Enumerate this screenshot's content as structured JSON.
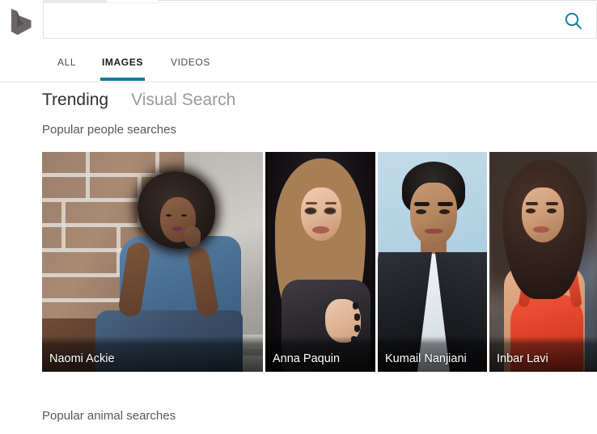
{
  "brand": {
    "logo_name": "bing-logo"
  },
  "search": {
    "value": "",
    "placeholder": "",
    "button_icon": "search-icon",
    "icon_color": "#0d7ba0"
  },
  "nav": {
    "tabs": [
      {
        "label": "ALL",
        "active": false
      },
      {
        "label": "IMAGES",
        "active": true
      },
      {
        "label": "VIDEOS",
        "active": false
      }
    ],
    "active_underline_color": "#0d7ba0"
  },
  "switcher": {
    "items": [
      {
        "label": "Trending",
        "selected": true
      },
      {
        "label": "Visual Search",
        "selected": false
      }
    ]
  },
  "sections": {
    "people_title": "Popular people searches",
    "animal_title": "Popular animal searches"
  },
  "trending_people": [
    {
      "name": "Naomi Ackie"
    },
    {
      "name": "Anna Paquin"
    },
    {
      "name": "Kumail Nanjiani"
    },
    {
      "name": "Inbar Lavi"
    }
  ]
}
